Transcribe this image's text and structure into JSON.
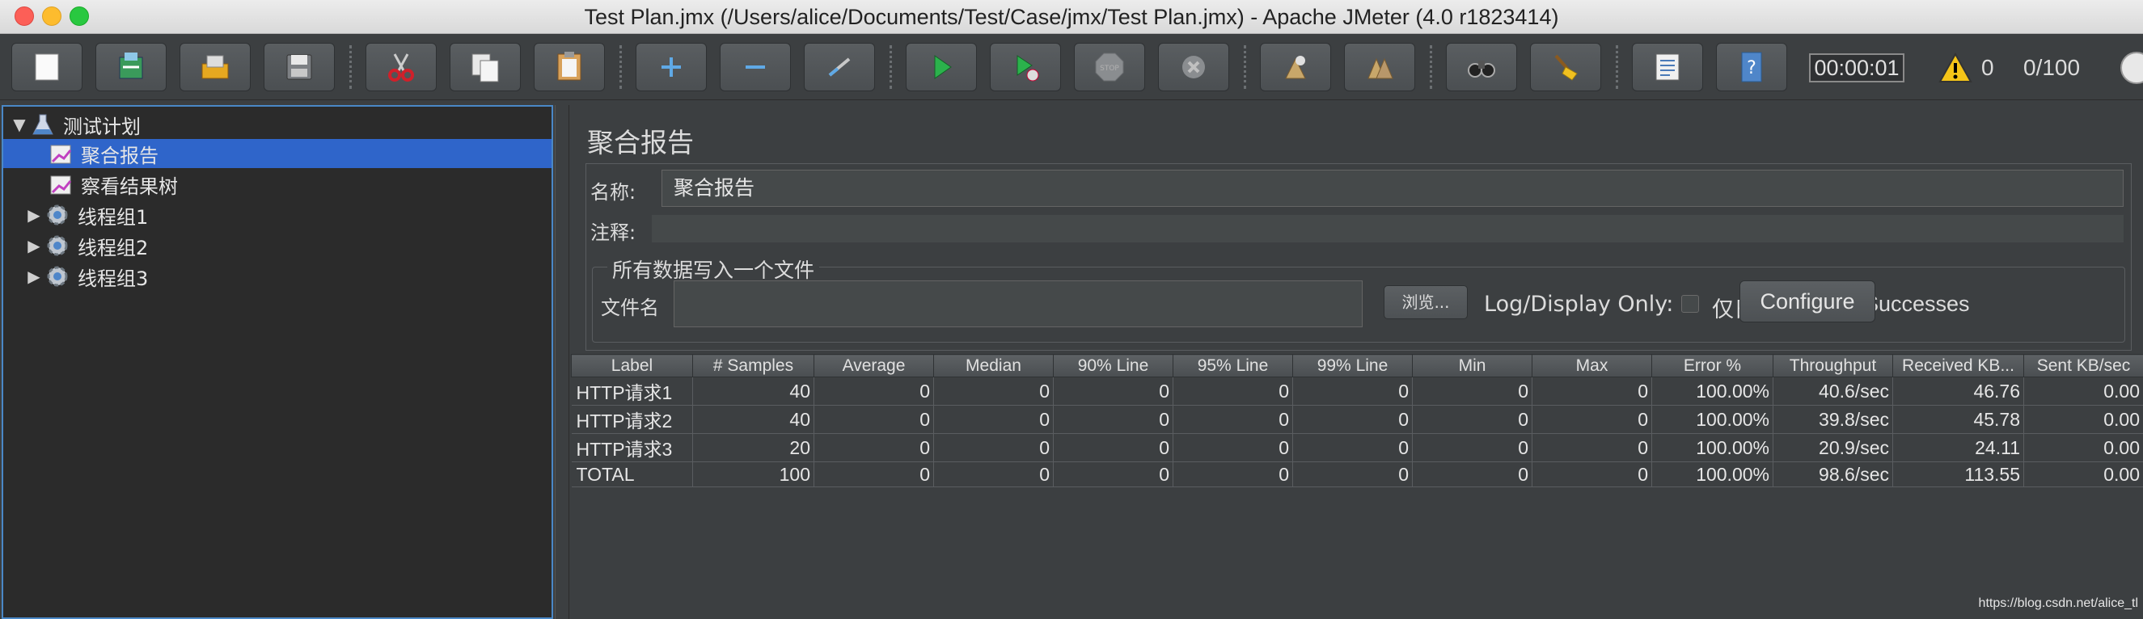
{
  "window": {
    "title": "Test Plan.jmx (/Users/alice/Documents/Test/Case/jmx/Test Plan.jmx) - Apache JMeter (4.0 r1823414)"
  },
  "toolbar": {
    "buttons": [
      "new-icon",
      "templates-icon",
      "open-icon",
      "save-icon",
      "cut-icon",
      "copy-icon",
      "paste-icon",
      "expand-icon",
      "collapse-icon",
      "toggle-icon",
      "start-icon",
      "start-no-pause-icon",
      "stop-icon",
      "shutdown-icon",
      "clear-icon",
      "clear-all-icon",
      "search-icon",
      "reset-search-icon",
      "function-helper-icon",
      "help-icon"
    ],
    "timer": "00:00:01",
    "warning_count": "0",
    "threads": "0/100"
  },
  "tree": {
    "root": "测试计划",
    "items": [
      {
        "label": "聚合报告",
        "selected": true
      },
      {
        "label": "察看结果树",
        "selected": false
      },
      {
        "label": "线程组1",
        "selected": false
      },
      {
        "label": "线程组2",
        "selected": false
      },
      {
        "label": "线程组3",
        "selected": false
      }
    ]
  },
  "panel": {
    "title": "聚合报告",
    "name_label": "名称:",
    "name_value": "聚合报告",
    "comment_label": "注释:",
    "file_group_title": "所有数据写入一个文件",
    "file_label": "文件名",
    "browse_label": "浏览...",
    "log_display_label": "Log/Display Only:",
    "errors_only_label": "仅日志错误",
    "successes_label": "Successes",
    "configure_label": "Configure"
  },
  "table": {
    "headers": [
      "Label",
      "# Samples",
      "Average",
      "Median",
      "90% Line",
      "95% Line",
      "99% Line",
      "Min",
      "Max",
      "Error %",
      "Throughput",
      "Received KB...",
      "Sent KB/sec"
    ],
    "rows": [
      [
        "HTTP请求1",
        "40",
        "0",
        "0",
        "0",
        "0",
        "0",
        "0",
        "0",
        "100.00%",
        "40.6/sec",
        "46.76",
        "0.00"
      ],
      [
        "HTTP请求2",
        "40",
        "0",
        "0",
        "0",
        "0",
        "0",
        "0",
        "0",
        "100.00%",
        "39.8/sec",
        "45.78",
        "0.00"
      ],
      [
        "HTTP请求3",
        "20",
        "0",
        "0",
        "0",
        "0",
        "0",
        "0",
        "0",
        "100.00%",
        "20.9/sec",
        "24.11",
        "0.00"
      ],
      [
        "TOTAL",
        "100",
        "0",
        "0",
        "0",
        "0",
        "0",
        "0",
        "0",
        "100.00%",
        "98.6/sec",
        "113.55",
        "0.00"
      ]
    ]
  },
  "watermark": "https://blog.csdn.net/alice_tl"
}
